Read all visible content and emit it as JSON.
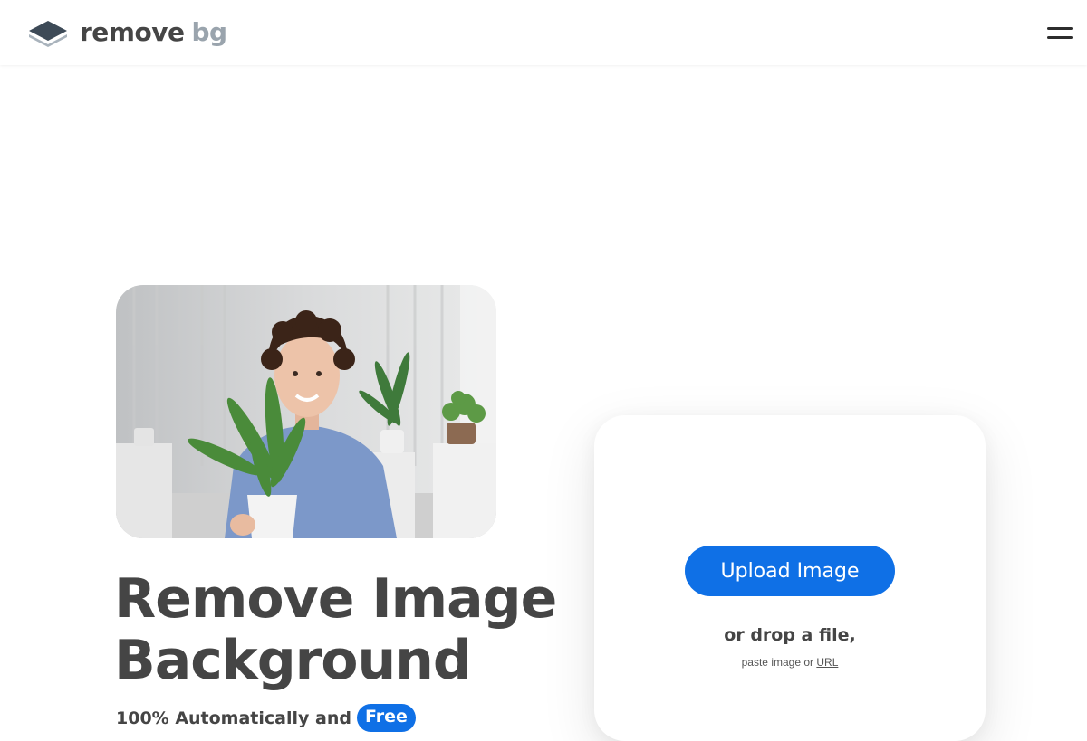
{
  "header": {
    "logo_word1": "remove",
    "logo_word2": "bg",
    "logo_icon": "layers-logo-icon",
    "menu_icon": "hamburger-menu-icon"
  },
  "hero": {
    "headline_line1": "Remove Image",
    "headline_line2": "Background",
    "subline_text": "100% Automatically and",
    "subline_badge": "Free"
  },
  "upload": {
    "button_label": "Upload Image",
    "drop_text": "or drop a file,",
    "paste_prefix": "paste image or",
    "url_link": "URL"
  },
  "colors": {
    "accent": "#0f70e6",
    "text": "#454545",
    "logo_secondary": "#9aa4ad"
  }
}
